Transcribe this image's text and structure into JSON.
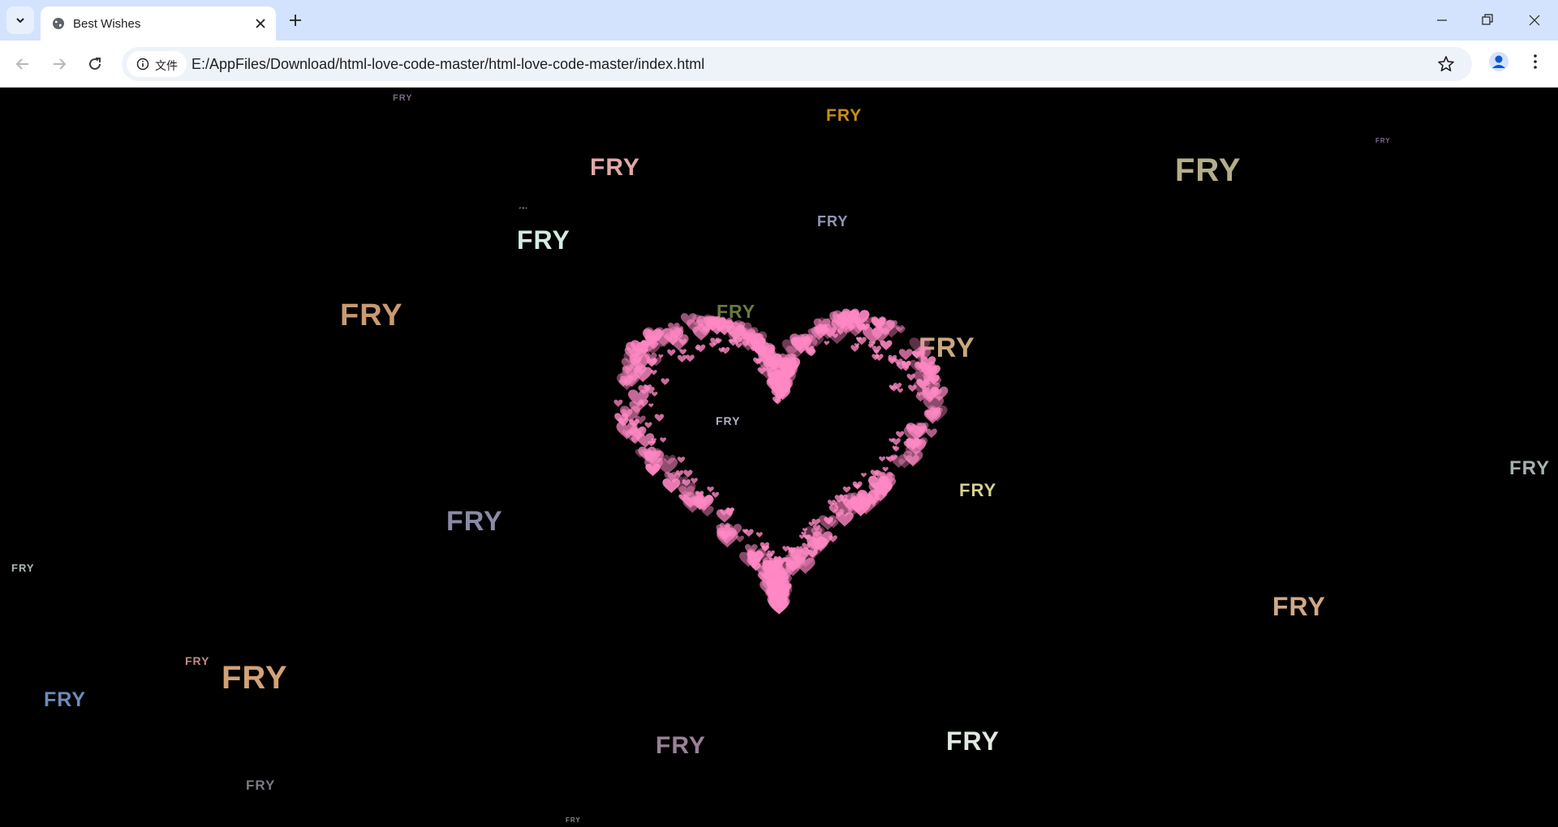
{
  "browser": {
    "tab": {
      "title": "Best Wishes"
    },
    "address": {
      "chip_label": "文件",
      "url": "E:/AppFiles/Download/html-love-code-master/html-love-code-master/index.html"
    },
    "colors": {
      "tabbar": "#d3e3fd",
      "toolbar": "#ffffff",
      "omnibox": "#eef2f9",
      "profile": "#0b57d0"
    }
  },
  "page": {
    "background": "#000000",
    "floating_word": "FRY",
    "heart_color": "#ff88c4",
    "floating_texts": [
      {
        "text": "FRY",
        "color": "#7a6a86"
      },
      {
        "text": "FRY",
        "color": "#c98f14"
      },
      {
        "text": "FRY",
        "color": "#7d6d8a"
      },
      {
        "text": "FRY",
        "color": "#e0a8a8"
      },
      {
        "text": "FRY",
        "color": "#b5ae8c"
      },
      {
        "text": "FRY",
        "color": "#8f98b8"
      },
      {
        "text": "FRY",
        "color": "#d4ece0"
      },
      {
        "text": "FRY",
        "color": "#c99a72"
      },
      {
        "text": "FRY",
        "color": "#6a7a3a"
      },
      {
        "text": "FRY",
        "color": "#b0b0c8"
      },
      {
        "text": "FRY",
        "color": "#c9a97c"
      },
      {
        "text": "FRY",
        "color": "#a6b0b0"
      },
      {
        "text": "FRY",
        "color": "#d6d094"
      },
      {
        "text": "FRY",
        "color": "#8a8aa8"
      },
      {
        "text": "FRY",
        "color": "#a8bcb4"
      },
      {
        "text": "FRY",
        "color": "#d2a886"
      },
      {
        "text": "FRY",
        "color": "#c08a8a"
      },
      {
        "text": "FRY",
        "color": "#d2a276"
      },
      {
        "text": "FRY",
        "color": "#6c8cbc"
      },
      {
        "text": "FRY",
        "color": "#9a8098"
      },
      {
        "text": "FRY",
        "color": "#e0eae0"
      },
      {
        "text": "FRY",
        "color": "#7a7a88"
      },
      {
        "text": "FRY",
        "color": "#8a8a8a"
      },
      {
        "text": "FRY",
        "color": "#9a9aaa"
      }
    ]
  }
}
